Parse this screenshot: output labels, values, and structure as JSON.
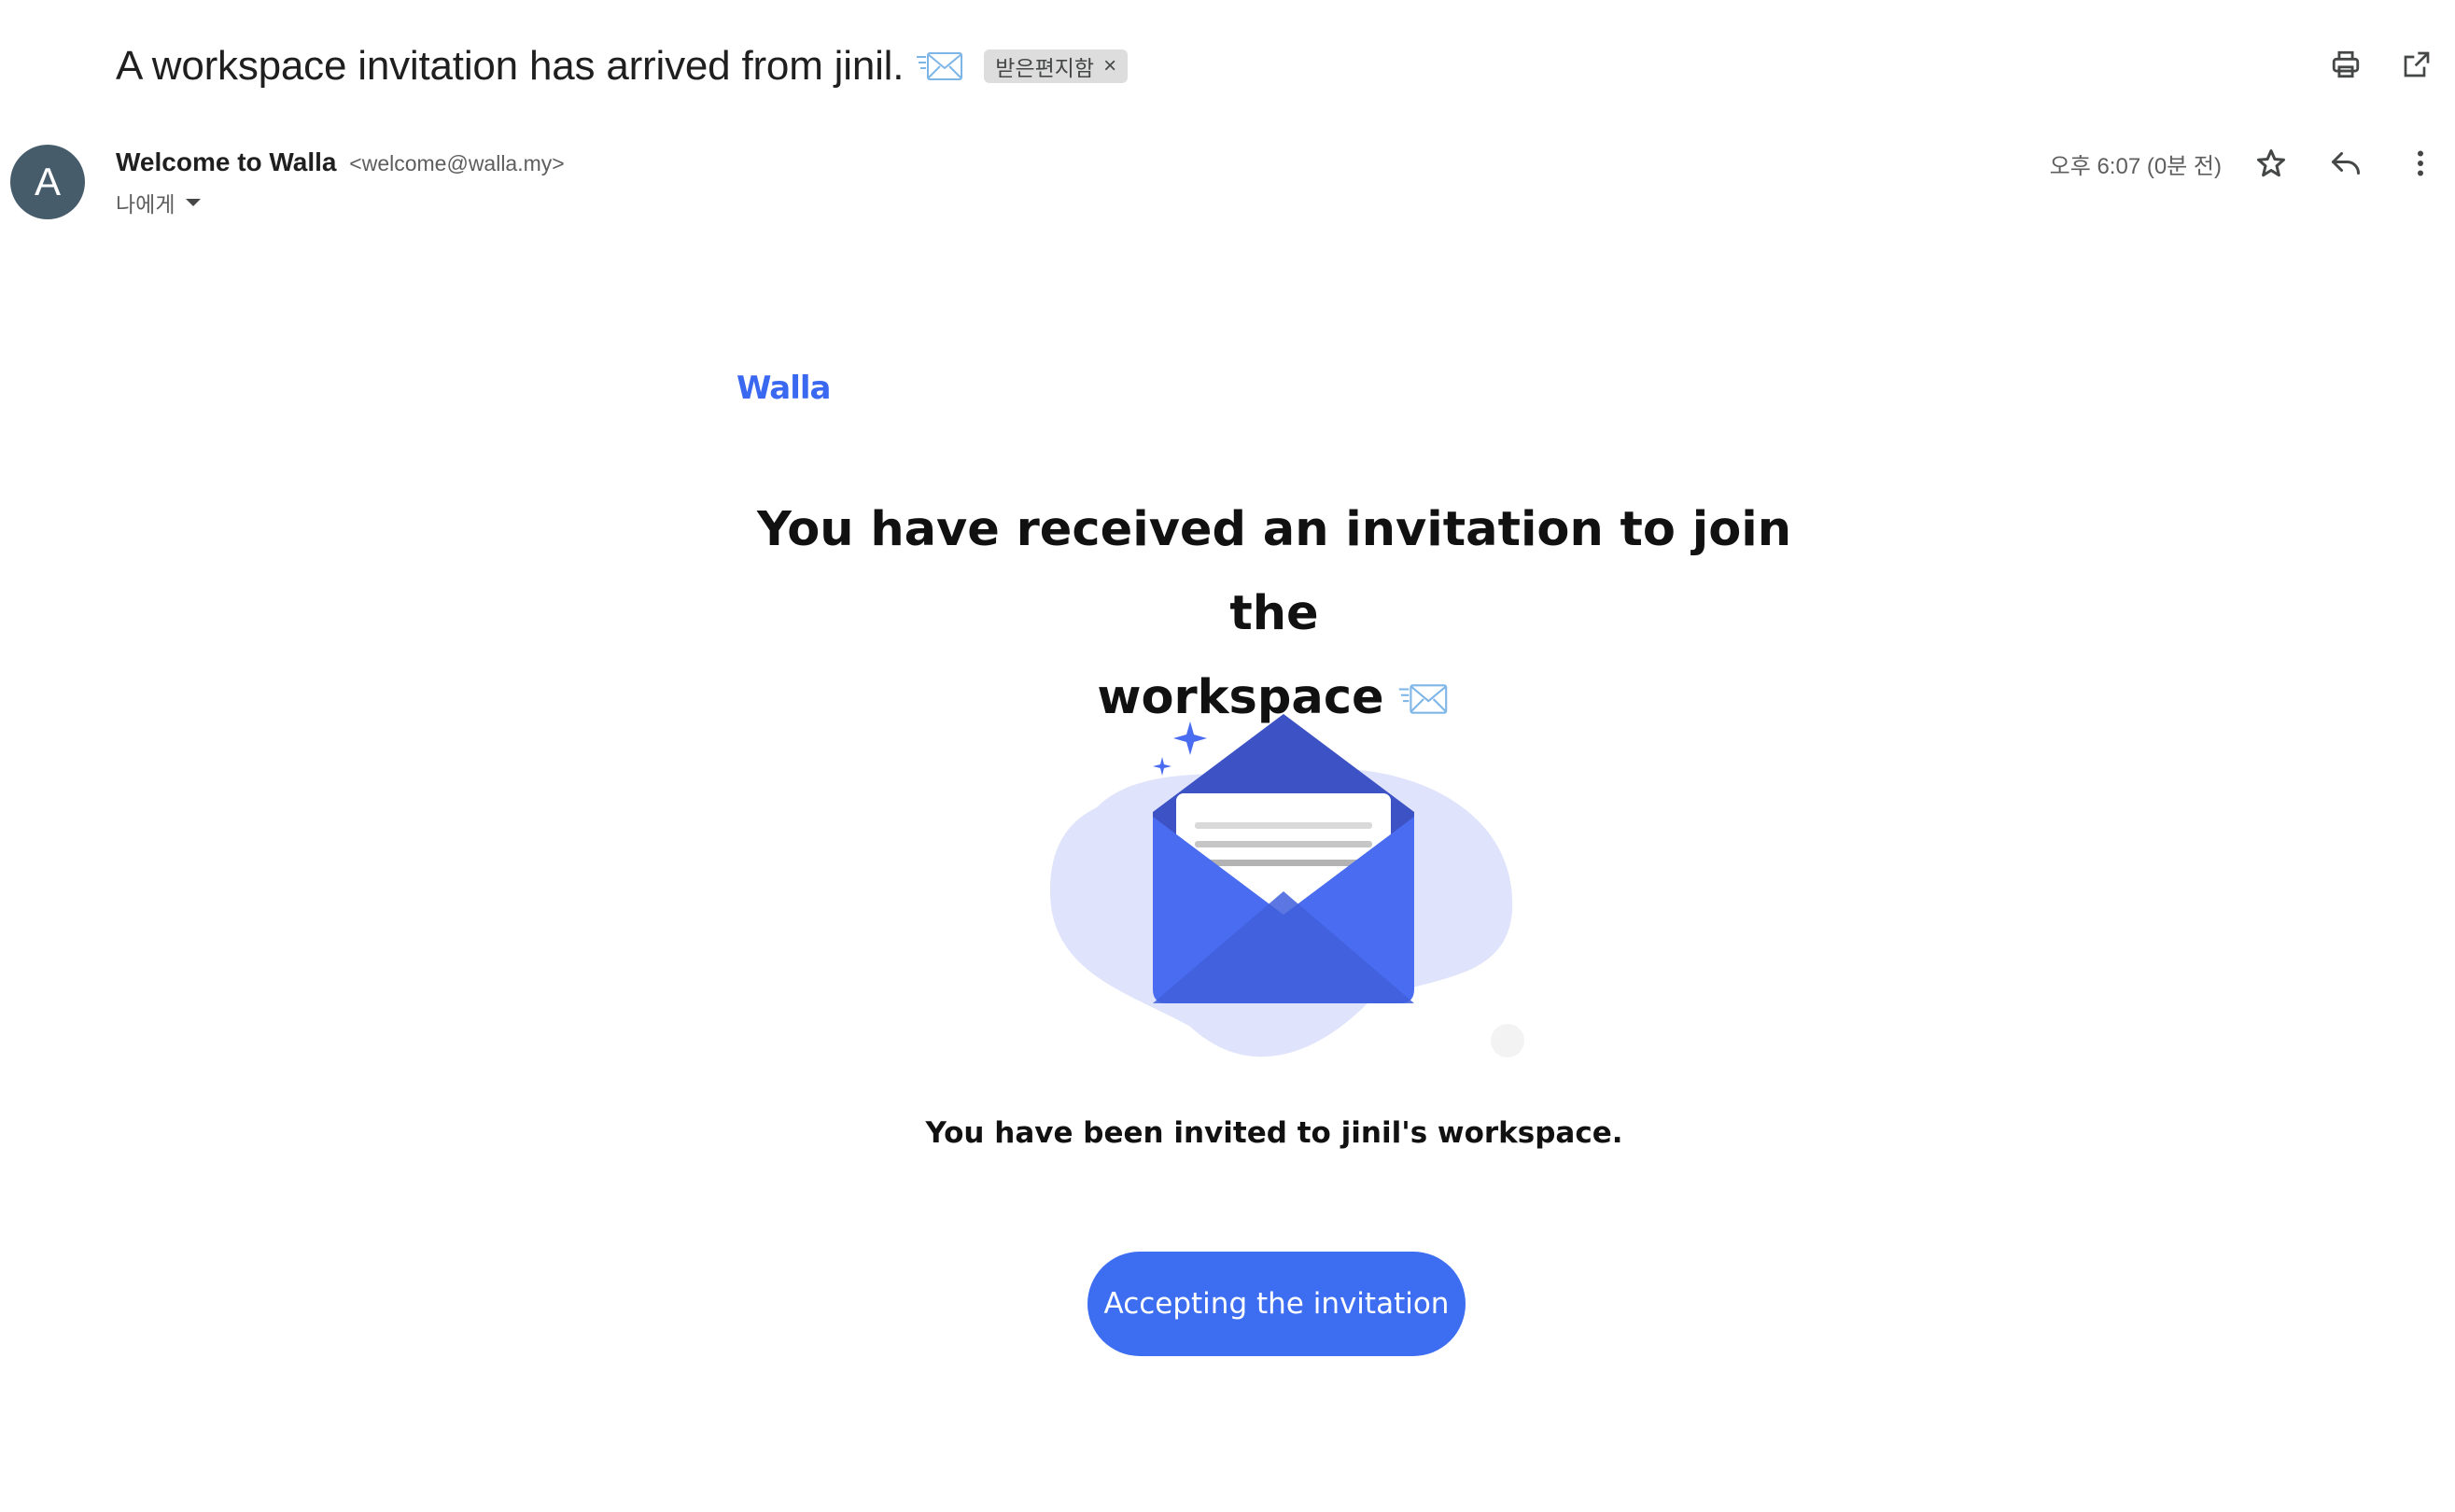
{
  "email": {
    "subject": "A workspace invitation has arrived from jinil.",
    "label": "받은편지함",
    "label_remove": "×",
    "sender_name": "Welcome to Walla",
    "sender_email": "<welcome@walla.my>",
    "recipient": "나에게",
    "timestamp": "오후 6:07 (0분 전)",
    "avatar_letter": "A"
  },
  "icons": {
    "subject": "envelope-with-arrow-icon",
    "print": "print-icon",
    "popout": "open-in-new-window-icon",
    "star": "star-icon",
    "reply": "reply-icon",
    "more": "more-vert-icon",
    "caret": "caret-down-icon"
  },
  "body": {
    "brand": "Walla",
    "headline_line1": "You have received an invitation to join the",
    "headline_line2": "workspace",
    "invite_text": "You have been invited to jinil's workspace.",
    "cta_label": "Accepting the invitation"
  },
  "colors": {
    "accent": "#3d6ef2",
    "envelope": "#4a6cf0",
    "envelope_dark": "#3650c8",
    "blob": "#dfe3fb",
    "avatar": "#475c6b"
  }
}
